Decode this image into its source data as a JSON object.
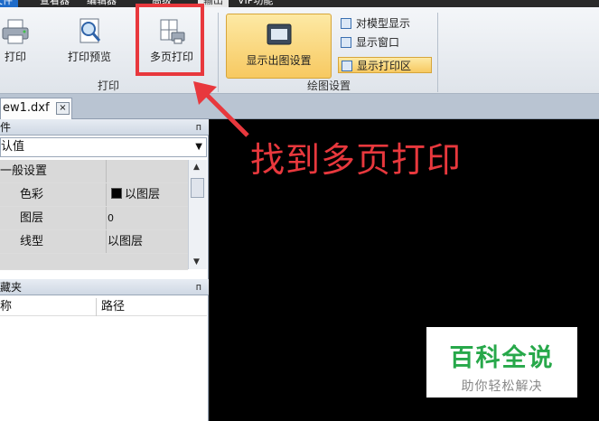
{
  "menubar": {
    "items": [
      "文件",
      "查看器",
      "编辑器",
      "高级",
      "输出",
      "VIP功能"
    ]
  },
  "ribbon": {
    "print_label": "打印",
    "print_preview_label": "打印预览",
    "multi_page_print_label": "多页打印",
    "print_group_label": "打印",
    "show_settings_label": "显示出图设置",
    "opt_model_display": "对模型显示",
    "opt_show_window": "显示窗口",
    "opt_show_print_area": "显示打印区",
    "plot_settings_group_label": "绘图设置"
  },
  "tabs": {
    "doc_name": "ew1.dxf",
    "close": "×"
  },
  "properties_panel": {
    "title": "件",
    "pin": "ᴨ",
    "combo_value": "认值",
    "rows": [
      {
        "key": "一般设置",
        "value": ""
      },
      {
        "key": "色彩",
        "value": "以图层"
      },
      {
        "key": "图层",
        "value": "0"
      },
      {
        "key": "线型",
        "value": "以图层"
      }
    ]
  },
  "favorites_panel": {
    "title": "藏夹",
    "pin": "ᴨ",
    "col_name": "称",
    "col_path": "路径"
  },
  "annotation": {
    "text": "找到多页打印",
    "color": "#e8383d"
  },
  "watermark": {
    "title": "百科全说",
    "subtitle": "助你轻松解决"
  }
}
